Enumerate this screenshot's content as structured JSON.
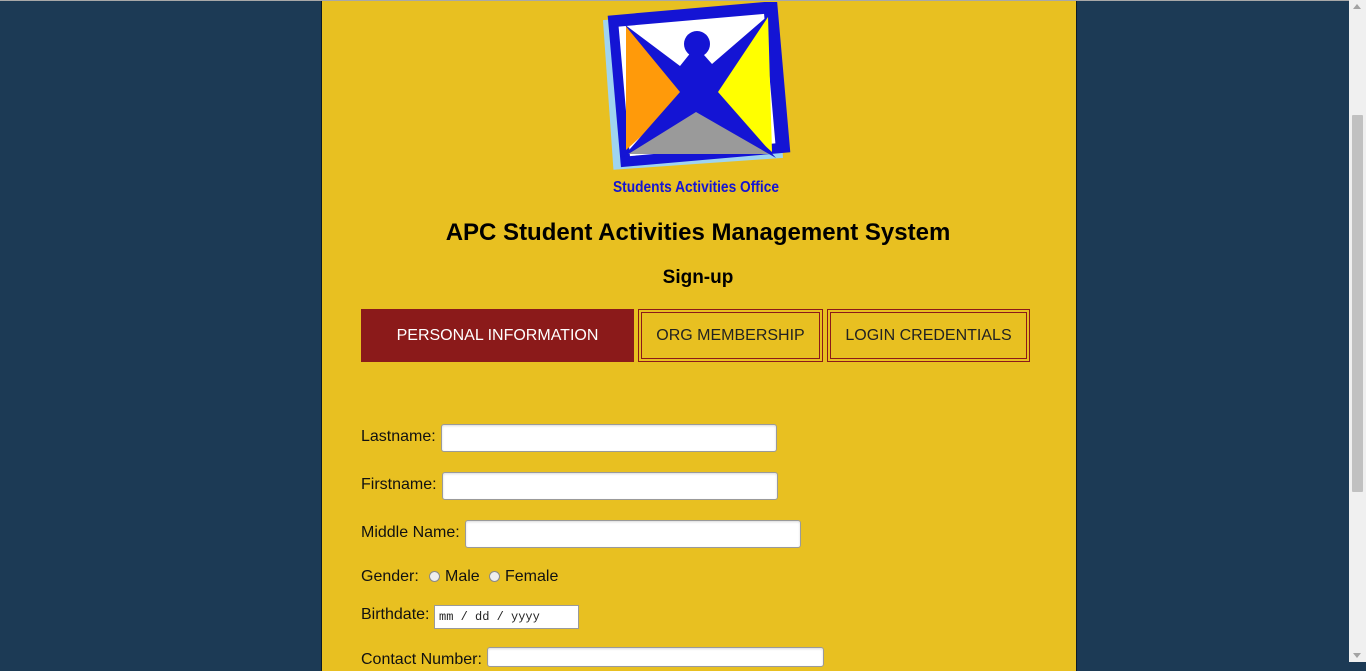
{
  "header": {
    "logo_text": "Students Activities Office",
    "title": "APC Student Activities Management System",
    "subtitle": "Sign-up"
  },
  "tabs": [
    {
      "label": "PERSONAL INFORMATION",
      "active": true
    },
    {
      "label": "ORG MEMBERSHIP",
      "active": false
    },
    {
      "label": "LOGIN CREDENTIALS",
      "active": false
    }
  ],
  "form": {
    "lastname_label": "Lastname:",
    "lastname_value": "",
    "firstname_label": "Firstname:",
    "firstname_value": "",
    "middlename_label": "Middle Name:",
    "middlename_value": "",
    "gender_label": "Gender:",
    "gender_male": "Male",
    "gender_female": "Female",
    "birthdate_label": "Birthdate:",
    "birthdate_placeholder": "mm / dd / yyyy",
    "contact_label": "Contact Number:"
  },
  "colors": {
    "background": "#1c3a55",
    "panel": "#e8c021",
    "accent": "#8b1a1a"
  }
}
